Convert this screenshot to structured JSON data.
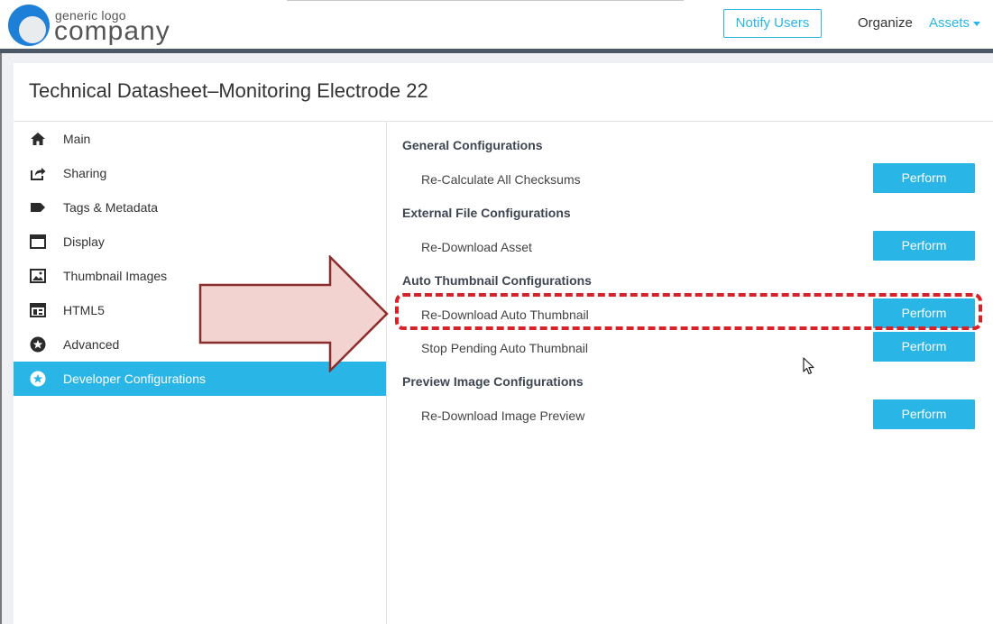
{
  "header": {
    "logo": {
      "small": "generic logo",
      "big": "company"
    },
    "notify_label": "Notify Users",
    "nav": {
      "organize": "Organize",
      "assets": "Assets"
    }
  },
  "page": {
    "title": "Technical Datasheet–Monitoring Electrode 22"
  },
  "sidebar": {
    "items": [
      {
        "label": "Main",
        "icon": "home-icon"
      },
      {
        "label": "Sharing",
        "icon": "share-icon"
      },
      {
        "label": "Tags & Metadata",
        "icon": "tag-icon"
      },
      {
        "label": "Display",
        "icon": "window-icon"
      },
      {
        "label": "Thumbnail Images",
        "icon": "image-icon"
      },
      {
        "label": "HTML5",
        "icon": "html5-icon"
      },
      {
        "label": "Advanced",
        "icon": "star-circle-icon"
      },
      {
        "label": "Developer Configurations",
        "icon": "star-circle-icon",
        "active": true
      }
    ]
  },
  "sections": [
    {
      "heading": "General Configurations",
      "rows": [
        {
          "label": "Re-Calculate All Checksums",
          "button": "Perform"
        }
      ]
    },
    {
      "heading": "External File Configurations",
      "rows": [
        {
          "label": "Re-Download Asset",
          "button": "Perform"
        }
      ]
    },
    {
      "heading": "Auto Thumbnail Configurations",
      "rows": [
        {
          "label": "Re-Download Auto Thumbnail",
          "button": "Perform",
          "highlighted": true
        },
        {
          "label": "Stop Pending Auto Thumbnail",
          "button": "Perform"
        }
      ]
    },
    {
      "heading": "Preview Image Configurations",
      "rows": [
        {
          "label": "Re-Download Image Preview",
          "button": "Perform"
        }
      ]
    }
  ],
  "colors": {
    "accent": "#29b6e6",
    "highlight": "#d7222a",
    "arrow_fill": "#f2d3d0",
    "arrow_stroke": "#8b2d2d",
    "header_divider": "#4d5866"
  }
}
